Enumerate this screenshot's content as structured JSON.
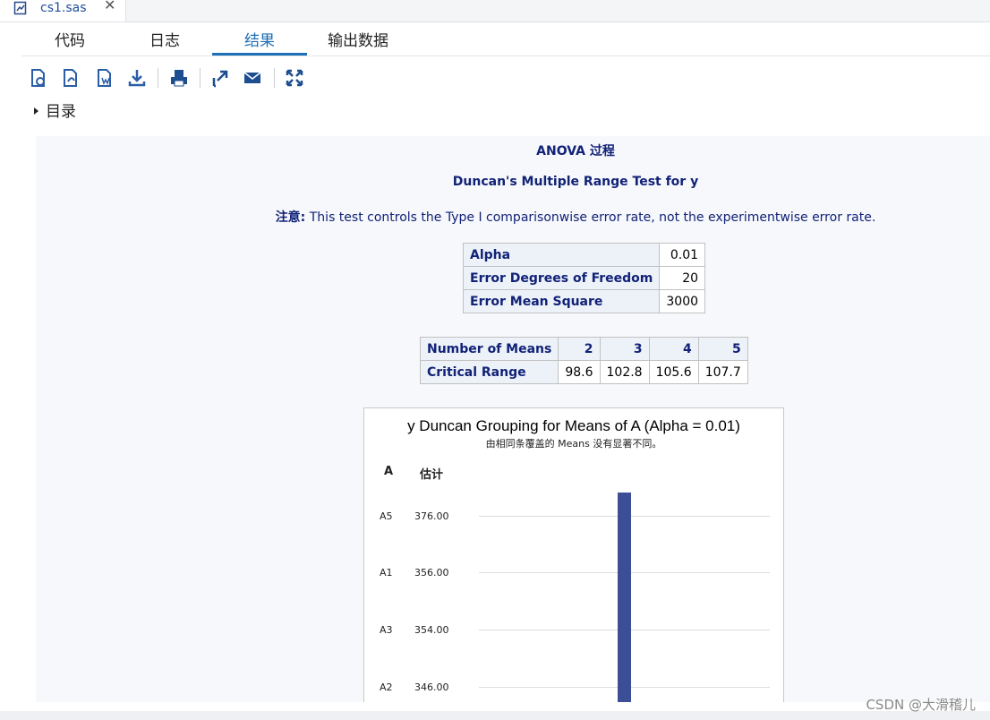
{
  "file_tab": {
    "name": "cs1.sas",
    "close_symbol": "✕",
    "icon": "sas-program-icon"
  },
  "tabs": [
    {
      "label": "代码",
      "active": false
    },
    {
      "label": "日志",
      "active": false
    },
    {
      "label": "结果",
      "active": true
    },
    {
      "label": "输出数据",
      "active": false
    }
  ],
  "toolbar": {
    "icons": [
      "html-export-icon",
      "pdf-export-icon",
      "word-export-icon",
      "download-icon",
      "print-icon",
      "open-in-new-window-icon",
      "email-icon",
      "maximize-icon"
    ]
  },
  "toc": {
    "label": "目录"
  },
  "results": {
    "title": "ANOVA 过程",
    "subtitle": "Duncan's Multiple Range Test for y",
    "note_label": "注意:",
    "note_text": "This test controls the Type I comparisonwise error rate, not the experimentwise error rate.",
    "stats_table": [
      {
        "label": "Alpha",
        "value": "0.01"
      },
      {
        "label": "Error Degrees of Freedom",
        "value": "20"
      },
      {
        "label": "Error Mean Square",
        "value": "3000"
      }
    ],
    "range_table": {
      "header_label": "Number of Means",
      "row_label": "Critical Range",
      "columns": [
        "2",
        "3",
        "4",
        "5"
      ],
      "values": [
        "98.6",
        "102.8",
        "105.6",
        "107.7"
      ]
    }
  },
  "chart_data": {
    "type": "table",
    "title": "y Duncan Grouping for Means of A (Alpha = 0.01)",
    "subtitle": "由相同条覆盖的 Means 没有显著不同。",
    "columns": [
      "A",
      "估计"
    ],
    "rows": [
      {
        "group": "A5",
        "estimate": "376.00"
      },
      {
        "group": "A1",
        "estimate": "356.00"
      },
      {
        "group": "A3",
        "estimate": "354.00"
      },
      {
        "group": "A2",
        "estimate": "346.00"
      }
    ],
    "bar_color": "#3c4f96"
  },
  "watermark": "CSDN @大滑稽儿"
}
